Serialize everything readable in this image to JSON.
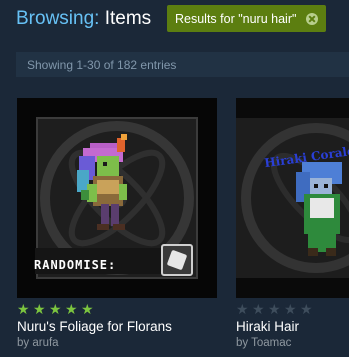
{
  "header": {
    "prefix": "Browsing:",
    "title": "Items"
  },
  "filter": {
    "label": "Results for \"nuru hair\""
  },
  "showing": "Showing 1-30 of 182 entries",
  "items": [
    {
      "title": "Nuru's Foliage for Florans",
      "author": "by arufa",
      "rating": 5,
      "rating_stars": "★★★★★",
      "overlay_text": "RANDOMISE:"
    },
    {
      "title": "Hiraki Hair",
      "author": "by Toamac",
      "rating": 0,
      "rating_stars": "★★★★★",
      "overlay_text": "Hiraki Corale"
    }
  ],
  "colors": {
    "background": "#1b2838",
    "accent": "#67c1f5",
    "filter_bg": "#5c7e10",
    "star_filled": "#7cc53f",
    "star_empty": "#3e4d5c"
  }
}
